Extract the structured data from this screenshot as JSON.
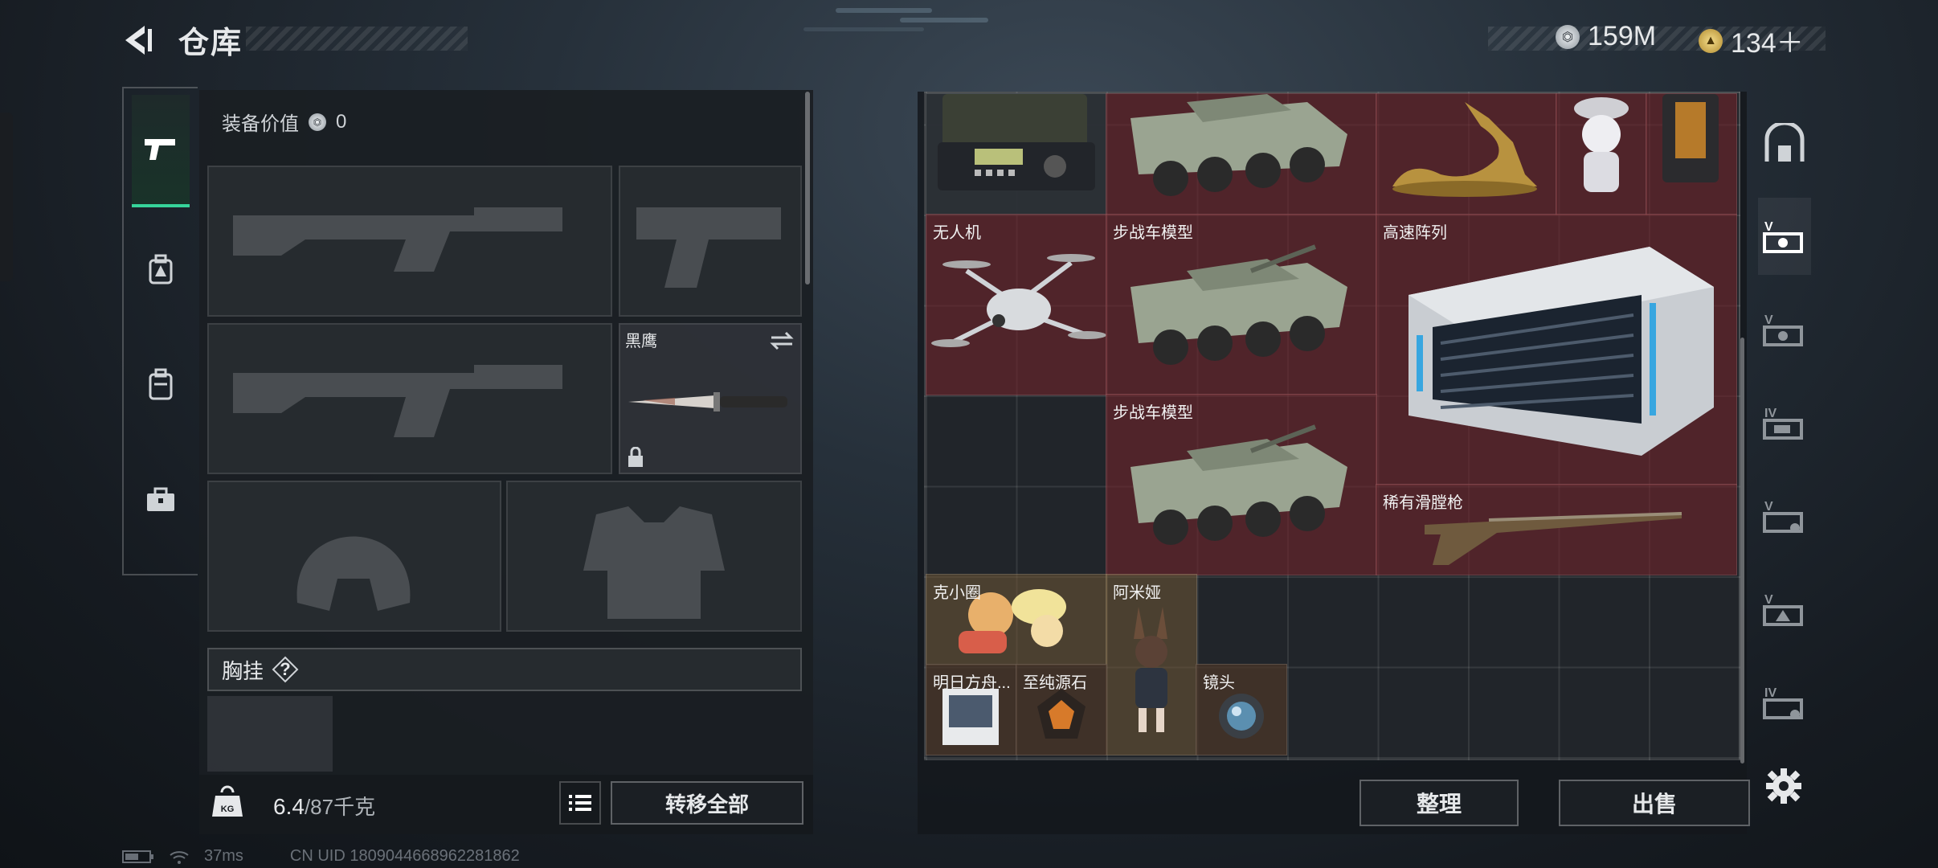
{
  "header": {
    "title": "仓库",
    "currencies": [
      {
        "icon": "silver-coin-icon",
        "value": "159M"
      },
      {
        "icon": "gold-coin-icon",
        "value": "134＋"
      }
    ]
  },
  "left_tabs": [
    {
      "icon": "pistol-icon",
      "active": true
    },
    {
      "icon": "backpack-armor-icon",
      "active": false
    },
    {
      "icon": "backpack-icon",
      "active": false
    },
    {
      "icon": "toolbox-icon",
      "active": false
    }
  ],
  "loadout": {
    "equip_value_label": "装备价值",
    "equip_value": "0",
    "knife_name": "黑鹰",
    "chest_rig_label": "胸挂",
    "chest_rig_help": "?"
  },
  "footer": {
    "weight_current": "6.4",
    "weight_max": "/87千克",
    "weight_icon_text": "KG",
    "transfer_all": "转移全部"
  },
  "items": [
    {
      "name": "",
      "icon": "radio-icon"
    },
    {
      "name": "",
      "icon": "ifv-model-icon"
    },
    {
      "name": "",
      "icon": "golden-deer-statue-icon"
    },
    {
      "name": "",
      "icon": "figurine-icon"
    },
    {
      "name": "",
      "icon": "bottle-icon"
    },
    {
      "name": "无人机",
      "icon": "drone-icon"
    },
    {
      "name": "步战车模型",
      "icon": "ifv-model-icon"
    },
    {
      "name": "高速阵列",
      "icon": "server-array-icon"
    },
    {
      "name": "步战车模型",
      "icon": "ifv-model-icon"
    },
    {
      "name": "稀有滑膛枪",
      "icon": "musket-icon"
    },
    {
      "name": "克小圈",
      "icon": "plush-doll-icon"
    },
    {
      "name": "阿米娅",
      "icon": "amiya-figure-icon"
    },
    {
      "name": "明日方舟...",
      "icon": "album-icon"
    },
    {
      "name": "至纯源石",
      "icon": "originium-icon"
    },
    {
      "name": "镜头",
      "icon": "lens-icon"
    }
  ],
  "actions": {
    "sort": "整理",
    "sell": "出售"
  },
  "status": {
    "ping": "37ms",
    "uid": "CN UID 1809044668962281862"
  }
}
